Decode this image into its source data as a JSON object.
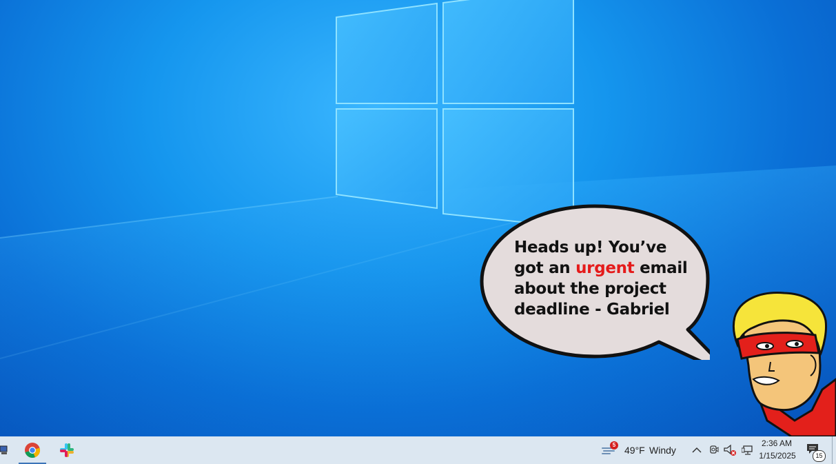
{
  "speech_bubble": {
    "line1": "Heads up! You’ve",
    "line2_pre": "got an ",
    "line2_emphasis": "urgent",
    "line2_post": " email",
    "line3": "about the project",
    "line4": "deadline - Gabriel",
    "emphasis_color": "#e51b1b"
  },
  "taskbar": {
    "pinned_apps": [
      "network-icon",
      "chrome-icon",
      "slack-icon"
    ],
    "weather": {
      "temperature": "49°F",
      "condition": "Windy",
      "badge_count": "5"
    },
    "clock": {
      "time": "2:36 AM",
      "date": "1/15/2025"
    },
    "notifications": {
      "count": "15"
    },
    "tray_icons": [
      "chevron-up-icon",
      "meet-now-icon",
      "speaker-muted-icon",
      "network-icon"
    ]
  },
  "colors": {
    "taskbar_bg": "#dce7f1",
    "desktop_accent": "#1596ee"
  }
}
